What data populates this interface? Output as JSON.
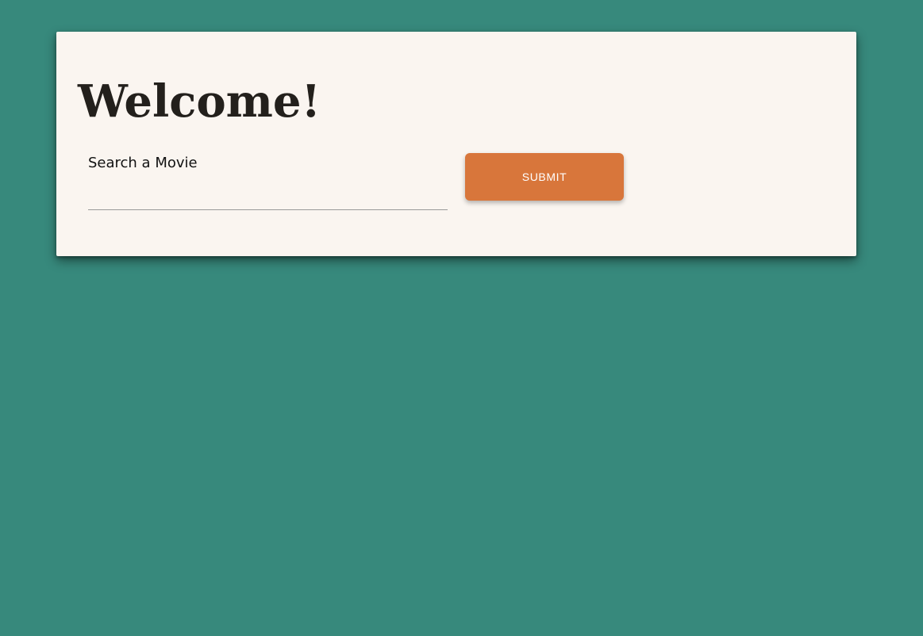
{
  "page": {
    "background_color": "#37897c"
  },
  "card": {
    "background_color": "#faf5f0",
    "title": "Welcome!"
  },
  "search": {
    "label": "Search a Movie",
    "value": "",
    "placeholder": ""
  },
  "submit": {
    "label": "SUBMIT",
    "color": "#d8763b"
  }
}
